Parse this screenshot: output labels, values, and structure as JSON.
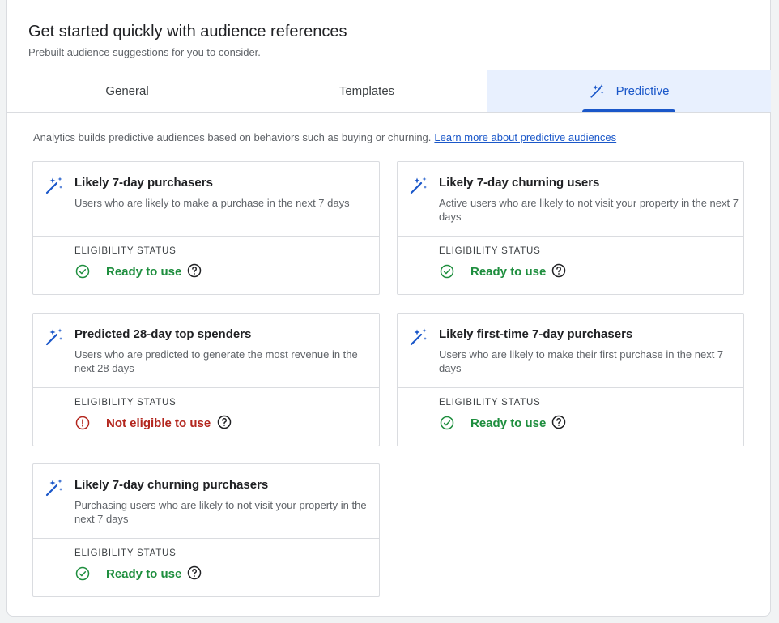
{
  "header": {
    "title": "Get started quickly with audience references",
    "subtitle": "Prebuilt audience suggestions for you to consider."
  },
  "tabs": [
    {
      "label": "General"
    },
    {
      "label": "Templates"
    },
    {
      "label": "Predictive",
      "active": true
    }
  ],
  "intro": {
    "text": "Analytics builds predictive audiences based on behaviors such as buying or churning.",
    "link": "Learn more about predictive audiences"
  },
  "colors": {
    "accent": "#1a57c9",
    "ready": "#1e8e3e",
    "not_eligible": "#b3261e",
    "active_tab_bg": "#e8f0fe"
  },
  "cards": [
    {
      "title": "Likely 7-day purchasers",
      "description": "Users who are likely to make a purchase in the next 7 days",
      "eligibility_label": "ELIGIBILITY STATUS",
      "status": "Ready to use",
      "status_type": "ready",
      "icon": "magic-wand-icon"
    },
    {
      "title": "Likely 7-day churning users",
      "description": "Active users who are likely to not visit your property in the next 7 days",
      "eligibility_label": "ELIGIBILITY STATUS",
      "status": "Ready to use",
      "status_type": "ready",
      "icon": "magic-wand-icon"
    },
    {
      "title": "Predicted 28-day top spenders",
      "description": "Users who are predicted to generate the most revenue in the next 28 days",
      "eligibility_label": "ELIGIBILITY STATUS",
      "status": "Not eligible to use",
      "status_type": "not_eligible",
      "icon": "magic-wand-icon"
    },
    {
      "title": "Likely first-time 7-day purchasers",
      "description": "Users who are likely to make their first purchase in the next 7 days",
      "eligibility_label": "ELIGIBILITY STATUS",
      "status": "Ready to use",
      "status_type": "ready",
      "icon": "magic-wand-icon"
    },
    {
      "title": "Likely 7-day churning purchasers",
      "description": "Purchasing users who are likely to not visit your property in the next 7 days",
      "eligibility_label": "ELIGIBILITY STATUS",
      "status": "Ready to use",
      "status_type": "ready",
      "icon": "magic-wand-icon"
    }
  ]
}
